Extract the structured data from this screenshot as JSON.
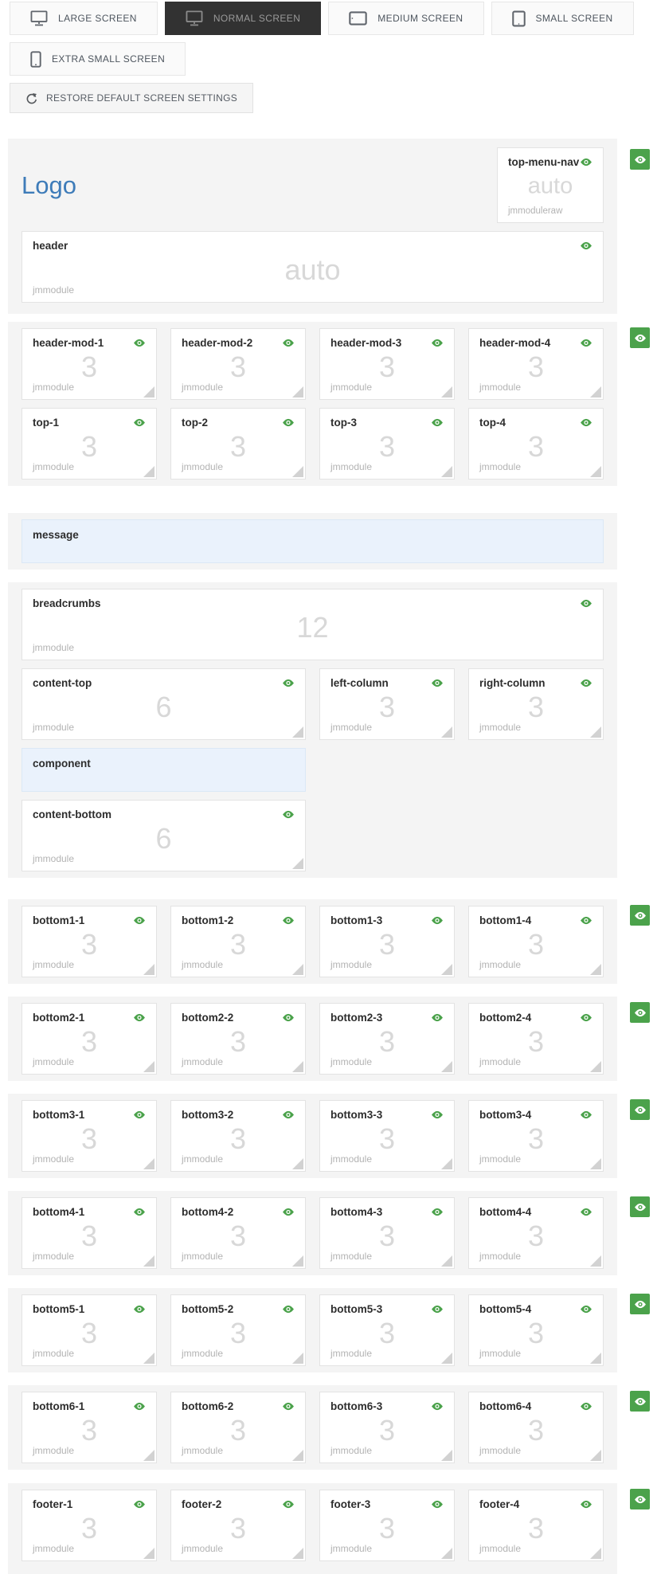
{
  "toolbar": {
    "screen_buttons": [
      {
        "label": "LARGE SCREEN",
        "icon": "desktop-icon",
        "active": false,
        "row": 1
      },
      {
        "label": "NORMAL SCREEN",
        "icon": "desktop-icon",
        "active": true,
        "row": 1
      },
      {
        "label": "MEDIUM SCREEN",
        "icon": "tablet-landscape-icon",
        "active": false,
        "row": 1
      },
      {
        "label": "SMALL SCREEN",
        "icon": "tablet-portrait-icon",
        "active": false,
        "row": 1
      },
      {
        "label": "EXTRA SMALL SCREEN",
        "icon": "phone-icon",
        "active": false,
        "row": 2
      }
    ],
    "restore_button": {
      "label": "RESTORE DEFAULT SCREEN SETTINGS",
      "icon": "redo-icon"
    }
  },
  "layout": {
    "logo_text": "Logo",
    "sections": [
      {
        "id": "top",
        "badge": true,
        "rows": [
          {
            "type": "logo",
            "positions": [
              {
                "name": "top-menu-nav",
                "value": "auto",
                "tag": "jmmoduleraw",
                "eye": true,
                "handle": false,
                "cols": 2
              }
            ]
          },
          {
            "type": "grid",
            "positions": [
              {
                "name": "header",
                "value": "auto",
                "tag": "jmmodule",
                "eye": true,
                "handle": false,
                "cols": 12
              }
            ]
          }
        ]
      },
      {
        "id": "header-mods",
        "badge": true,
        "rows": [
          {
            "type": "grid",
            "positions": [
              {
                "name": "header-mod-1",
                "value": "3",
                "tag": "jmmodule",
                "eye": true,
                "handle": true,
                "cols": 3
              },
              {
                "name": "header-mod-2",
                "value": "3",
                "tag": "jmmodule",
                "eye": true,
                "handle": true,
                "cols": 3
              },
              {
                "name": "header-mod-3",
                "value": "3",
                "tag": "jmmodule",
                "eye": true,
                "handle": true,
                "cols": 3
              },
              {
                "name": "header-mod-4",
                "value": "3",
                "tag": "jmmodule",
                "eye": true,
                "handle": true,
                "cols": 3
              }
            ]
          },
          {
            "type": "grid",
            "positions": [
              {
                "name": "top-1",
                "value": "3",
                "tag": "jmmodule",
                "eye": true,
                "handle": true,
                "cols": 3
              },
              {
                "name": "top-2",
                "value": "3",
                "tag": "jmmodule",
                "eye": true,
                "handle": true,
                "cols": 3
              },
              {
                "name": "top-3",
                "value": "3",
                "tag": "jmmodule",
                "eye": true,
                "handle": true,
                "cols": 3
              },
              {
                "name": "top-4",
                "value": "3",
                "tag": "jmmodule",
                "eye": true,
                "handle": true,
                "cols": 3
              }
            ]
          }
        ]
      },
      {
        "id": "message",
        "badge": false,
        "rows": [
          {
            "type": "grid",
            "positions": [
              {
                "name": "message",
                "banner": true,
                "cols": 12
              }
            ]
          }
        ]
      },
      {
        "id": "content",
        "badge": false,
        "rows": [
          {
            "type": "grid",
            "positions": [
              {
                "name": "breadcrumbs",
                "value": "12",
                "tag": "jmmodule",
                "eye": true,
                "handle": false,
                "cols": 12
              }
            ]
          },
          {
            "type": "grid",
            "positions": [
              {
                "name": "content-top",
                "value": "6",
                "tag": "jmmodule",
                "eye": true,
                "handle": true,
                "cols": 6
              },
              {
                "name": "left-column",
                "value": "3",
                "tag": "jmmodule",
                "eye": true,
                "handle": true,
                "cols": 3
              },
              {
                "name": "right-column",
                "value": "3",
                "tag": "jmmodule",
                "eye": true,
                "handle": true,
                "cols": 3
              }
            ]
          },
          {
            "type": "grid",
            "positions": [
              {
                "name": "component",
                "banner": true,
                "cols": 6
              }
            ]
          },
          {
            "type": "grid",
            "positions": [
              {
                "name": "content-bottom",
                "value": "6",
                "tag": "jmmodule",
                "eye": true,
                "handle": true,
                "cols": 6
              }
            ]
          }
        ]
      },
      {
        "id": "bottom-1",
        "badge": true,
        "rows": [
          {
            "type": "grid",
            "positions": [
              {
                "name": "bottom1-1",
                "value": "3",
                "tag": "jmmodule",
                "eye": true,
                "handle": true,
                "cols": 3
              },
              {
                "name": "bottom1-2",
                "value": "3",
                "tag": "jmmodule",
                "eye": true,
                "handle": true,
                "cols": 3
              },
              {
                "name": "bottom1-3",
                "value": "3",
                "tag": "jmmodule",
                "eye": true,
                "handle": true,
                "cols": 3
              },
              {
                "name": "bottom1-4",
                "value": "3",
                "tag": "jmmodule",
                "eye": true,
                "handle": true,
                "cols": 3
              }
            ]
          }
        ]
      },
      {
        "id": "bottom-2",
        "badge": true,
        "rows": [
          {
            "type": "grid",
            "positions": [
              {
                "name": "bottom2-1",
                "value": "3",
                "tag": "jmmodule",
                "eye": true,
                "handle": true,
                "cols": 3
              },
              {
                "name": "bottom2-2",
                "value": "3",
                "tag": "jmmodule",
                "eye": true,
                "handle": true,
                "cols": 3
              },
              {
                "name": "bottom2-3",
                "value": "3",
                "tag": "jmmodule",
                "eye": true,
                "handle": true,
                "cols": 3
              },
              {
                "name": "bottom2-4",
                "value": "3",
                "tag": "jmmodule",
                "eye": true,
                "handle": true,
                "cols": 3
              }
            ]
          }
        ]
      },
      {
        "id": "bottom-3",
        "badge": true,
        "rows": [
          {
            "type": "grid",
            "positions": [
              {
                "name": "bottom3-1",
                "value": "3",
                "tag": "jmmodule",
                "eye": true,
                "handle": true,
                "cols": 3
              },
              {
                "name": "bottom3-2",
                "value": "3",
                "tag": "jmmodule",
                "eye": true,
                "handle": true,
                "cols": 3
              },
              {
                "name": "bottom3-3",
                "value": "3",
                "tag": "jmmodule",
                "eye": true,
                "handle": true,
                "cols": 3
              },
              {
                "name": "bottom3-4",
                "value": "3",
                "tag": "jmmodule",
                "eye": true,
                "handle": true,
                "cols": 3
              }
            ]
          }
        ]
      },
      {
        "id": "bottom-4",
        "badge": true,
        "rows": [
          {
            "type": "grid",
            "positions": [
              {
                "name": "bottom4-1",
                "value": "3",
                "tag": "jmmodule",
                "eye": true,
                "handle": true,
                "cols": 3
              },
              {
                "name": "bottom4-2",
                "value": "3",
                "tag": "jmmodule",
                "eye": true,
                "handle": true,
                "cols": 3
              },
              {
                "name": "bottom4-3",
                "value": "3",
                "tag": "jmmodule",
                "eye": true,
                "handle": true,
                "cols": 3
              },
              {
                "name": "bottom4-4",
                "value": "3",
                "tag": "jmmodule",
                "eye": true,
                "handle": true,
                "cols": 3
              }
            ]
          }
        ]
      },
      {
        "id": "bottom-5",
        "badge": true,
        "rows": [
          {
            "type": "grid",
            "positions": [
              {
                "name": "bottom5-1",
                "value": "3",
                "tag": "jmmodule",
                "eye": true,
                "handle": true,
                "cols": 3
              },
              {
                "name": "bottom5-2",
                "value": "3",
                "tag": "jmmodule",
                "eye": true,
                "handle": true,
                "cols": 3
              },
              {
                "name": "bottom5-3",
                "value": "3",
                "tag": "jmmodule",
                "eye": true,
                "handle": true,
                "cols": 3
              },
              {
                "name": "bottom5-4",
                "value": "3",
                "tag": "jmmodule",
                "eye": true,
                "handle": true,
                "cols": 3
              }
            ]
          }
        ]
      },
      {
        "id": "bottom-6",
        "badge": true,
        "rows": [
          {
            "type": "grid",
            "positions": [
              {
                "name": "bottom6-1",
                "value": "3",
                "tag": "jmmodule",
                "eye": true,
                "handle": true,
                "cols": 3
              },
              {
                "name": "bottom6-2",
                "value": "3",
                "tag": "jmmodule",
                "eye": true,
                "handle": true,
                "cols": 3
              },
              {
                "name": "bottom6-3",
                "value": "3",
                "tag": "jmmodule",
                "eye": true,
                "handle": true,
                "cols": 3
              },
              {
                "name": "bottom6-4",
                "value": "3",
                "tag": "jmmodule",
                "eye": true,
                "handle": true,
                "cols": 3
              }
            ]
          }
        ]
      },
      {
        "id": "footer",
        "badge": true,
        "rows": [
          {
            "type": "grid",
            "positions": [
              {
                "name": "footer-1",
                "value": "3",
                "tag": "jmmodule",
                "eye": true,
                "handle": true,
                "cols": 3
              },
              {
                "name": "footer-2",
                "value": "3",
                "tag": "jmmodule",
                "eye": true,
                "handle": true,
                "cols": 3
              },
              {
                "name": "footer-3",
                "value": "3",
                "tag": "jmmodule",
                "eye": true,
                "handle": true,
                "cols": 3
              },
              {
                "name": "footer-4",
                "value": "3",
                "tag": "jmmodule",
                "eye": true,
                "handle": true,
                "cols": 3
              }
            ]
          }
        ]
      }
    ]
  },
  "colors": {
    "accent_green": "#4ba24b",
    "logo_blue": "#3e7cb9",
    "banner_blue_bg": "#eaf2fc",
    "banner_blue_border": "#dbe8f6",
    "section_bg": "#f4f4f4",
    "active_button_bg": "#323232"
  }
}
